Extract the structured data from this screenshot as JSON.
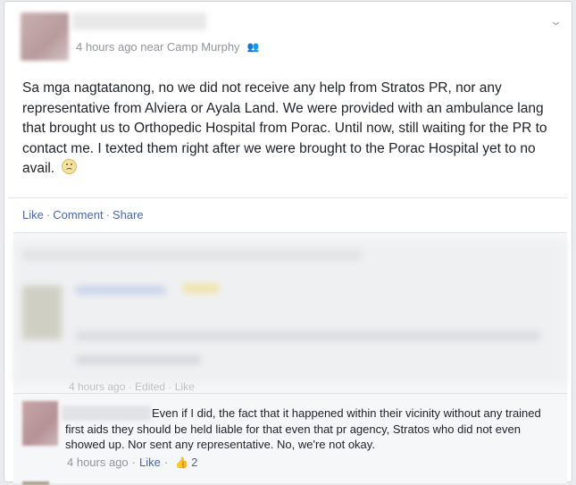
{
  "post": {
    "meta_time": "4 hours ago near Camp Murphy",
    "text": "Sa mga nagtatanong, no we did not receive any help from Stratos PR, nor any representative from Alviera or Ayala Land. We were provided with an ambulance lang that brought us to Orthopedic Hospital from Porac. Until now, still waiting for the PR to contact me. I texted them right after we were brought to the Porac Hospital yet to no avail.",
    "emoticon": "sad-face-icon"
  },
  "actions": {
    "like": "Like",
    "comment": "Comment",
    "share": "Share",
    "separator": "·"
  },
  "blurred_comment": {
    "meta": "4 hours ago · Edited · Like"
  },
  "comment": {
    "text": "Even if I did, the fact that it happened within their vicinity without any trained first aids they should be held liable for that even that pr agency, Stratos who did not even showed up. Nor sent any representative. No, we're not okay.",
    "time": "4 hours ago",
    "like": "Like",
    "like_count": "2"
  },
  "colors": {
    "link": "#4b67a1",
    "meta": "#90949c",
    "text": "#1d2129"
  }
}
